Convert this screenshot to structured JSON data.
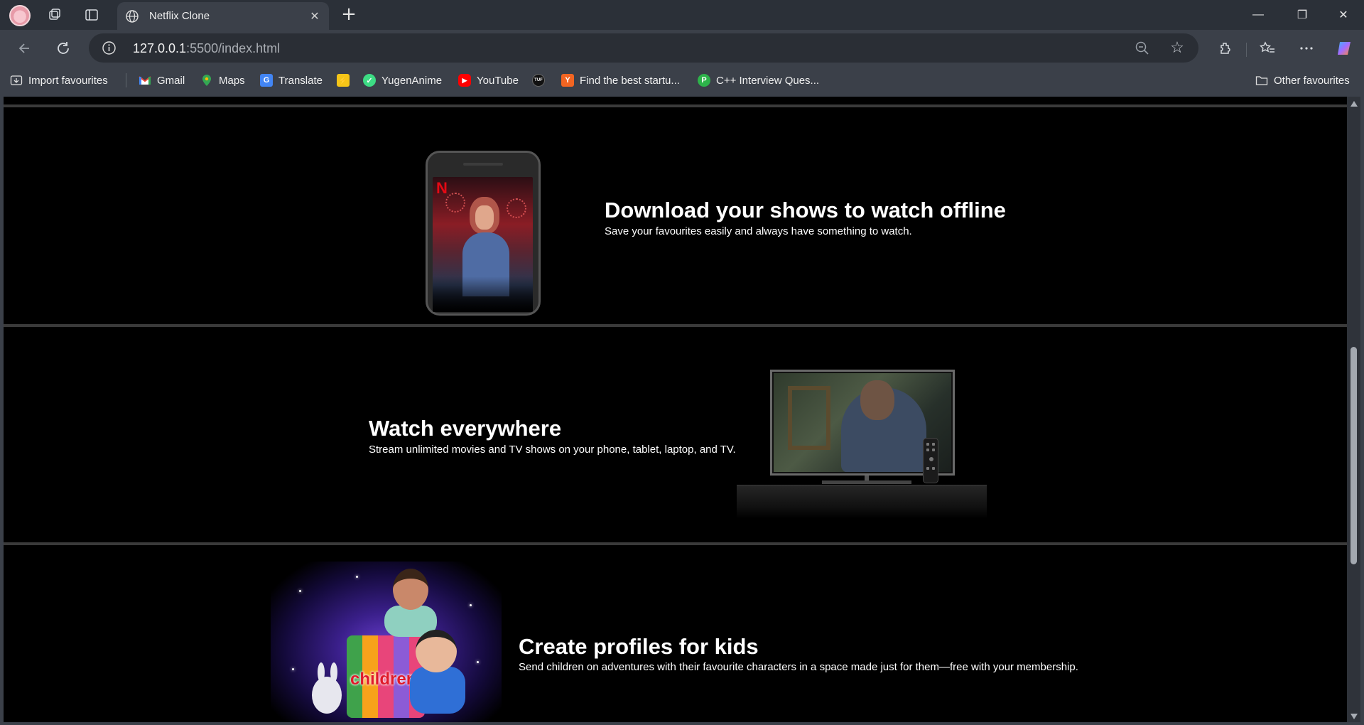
{
  "browser": {
    "tab": {
      "title": "Netflix Clone",
      "close_glyph": "✕"
    },
    "new_tab_glyph": "+",
    "address": {
      "host": "127.0.0.1",
      "path": ":5500/index.html"
    },
    "window_controls": {
      "minimize": "—",
      "restore": "❐",
      "close": "✕"
    },
    "bookmarks": [
      {
        "label": "Import favourites",
        "icon": "import-icon"
      },
      {
        "label": "Gmail",
        "icon": "gmail-icon",
        "color": "#ea4335"
      },
      {
        "label": "Maps",
        "icon": "maps-icon",
        "color": "#34a853"
      },
      {
        "label": "Translate",
        "icon": "translate-icon",
        "color": "#4285f4"
      },
      {
        "label": "",
        "icon": "pikachu-icon",
        "color": "#f5c518"
      },
      {
        "label": "YugenAnime",
        "icon": "yugenanime-icon",
        "color": "#3ddc84"
      },
      {
        "label": "YouTube",
        "icon": "youtube-icon",
        "color": "#ff0000"
      },
      {
        "label": "",
        "icon": "tuf-icon",
        "color": "#111111"
      },
      {
        "label": "Find the best startu...",
        "icon": "ycombinator-icon",
        "color": "#f26522"
      },
      {
        "label": "C++ Interview Ques...",
        "icon": "interview-icon",
        "color": "#2db34a"
      }
    ],
    "other_favourites": "Other favourites"
  },
  "features": [
    {
      "title": "Download your shows to watch offline",
      "text": "Save your favourites easily and always have something to watch."
    },
    {
      "title": "Watch everywhere",
      "text": "Stream unlimited movies and TV shows on your phone, tablet, laptop, and TV."
    },
    {
      "title": "Create profiles for kids",
      "text": "Send children on adventures with their favourite characters in a space made just for them—free with your membership.",
      "card_label": "children"
    }
  ],
  "phone_logo": "N",
  "colors": {
    "netflix_red": "#e50914",
    "page_bg": "#000000",
    "chrome": "#3b4049"
  }
}
